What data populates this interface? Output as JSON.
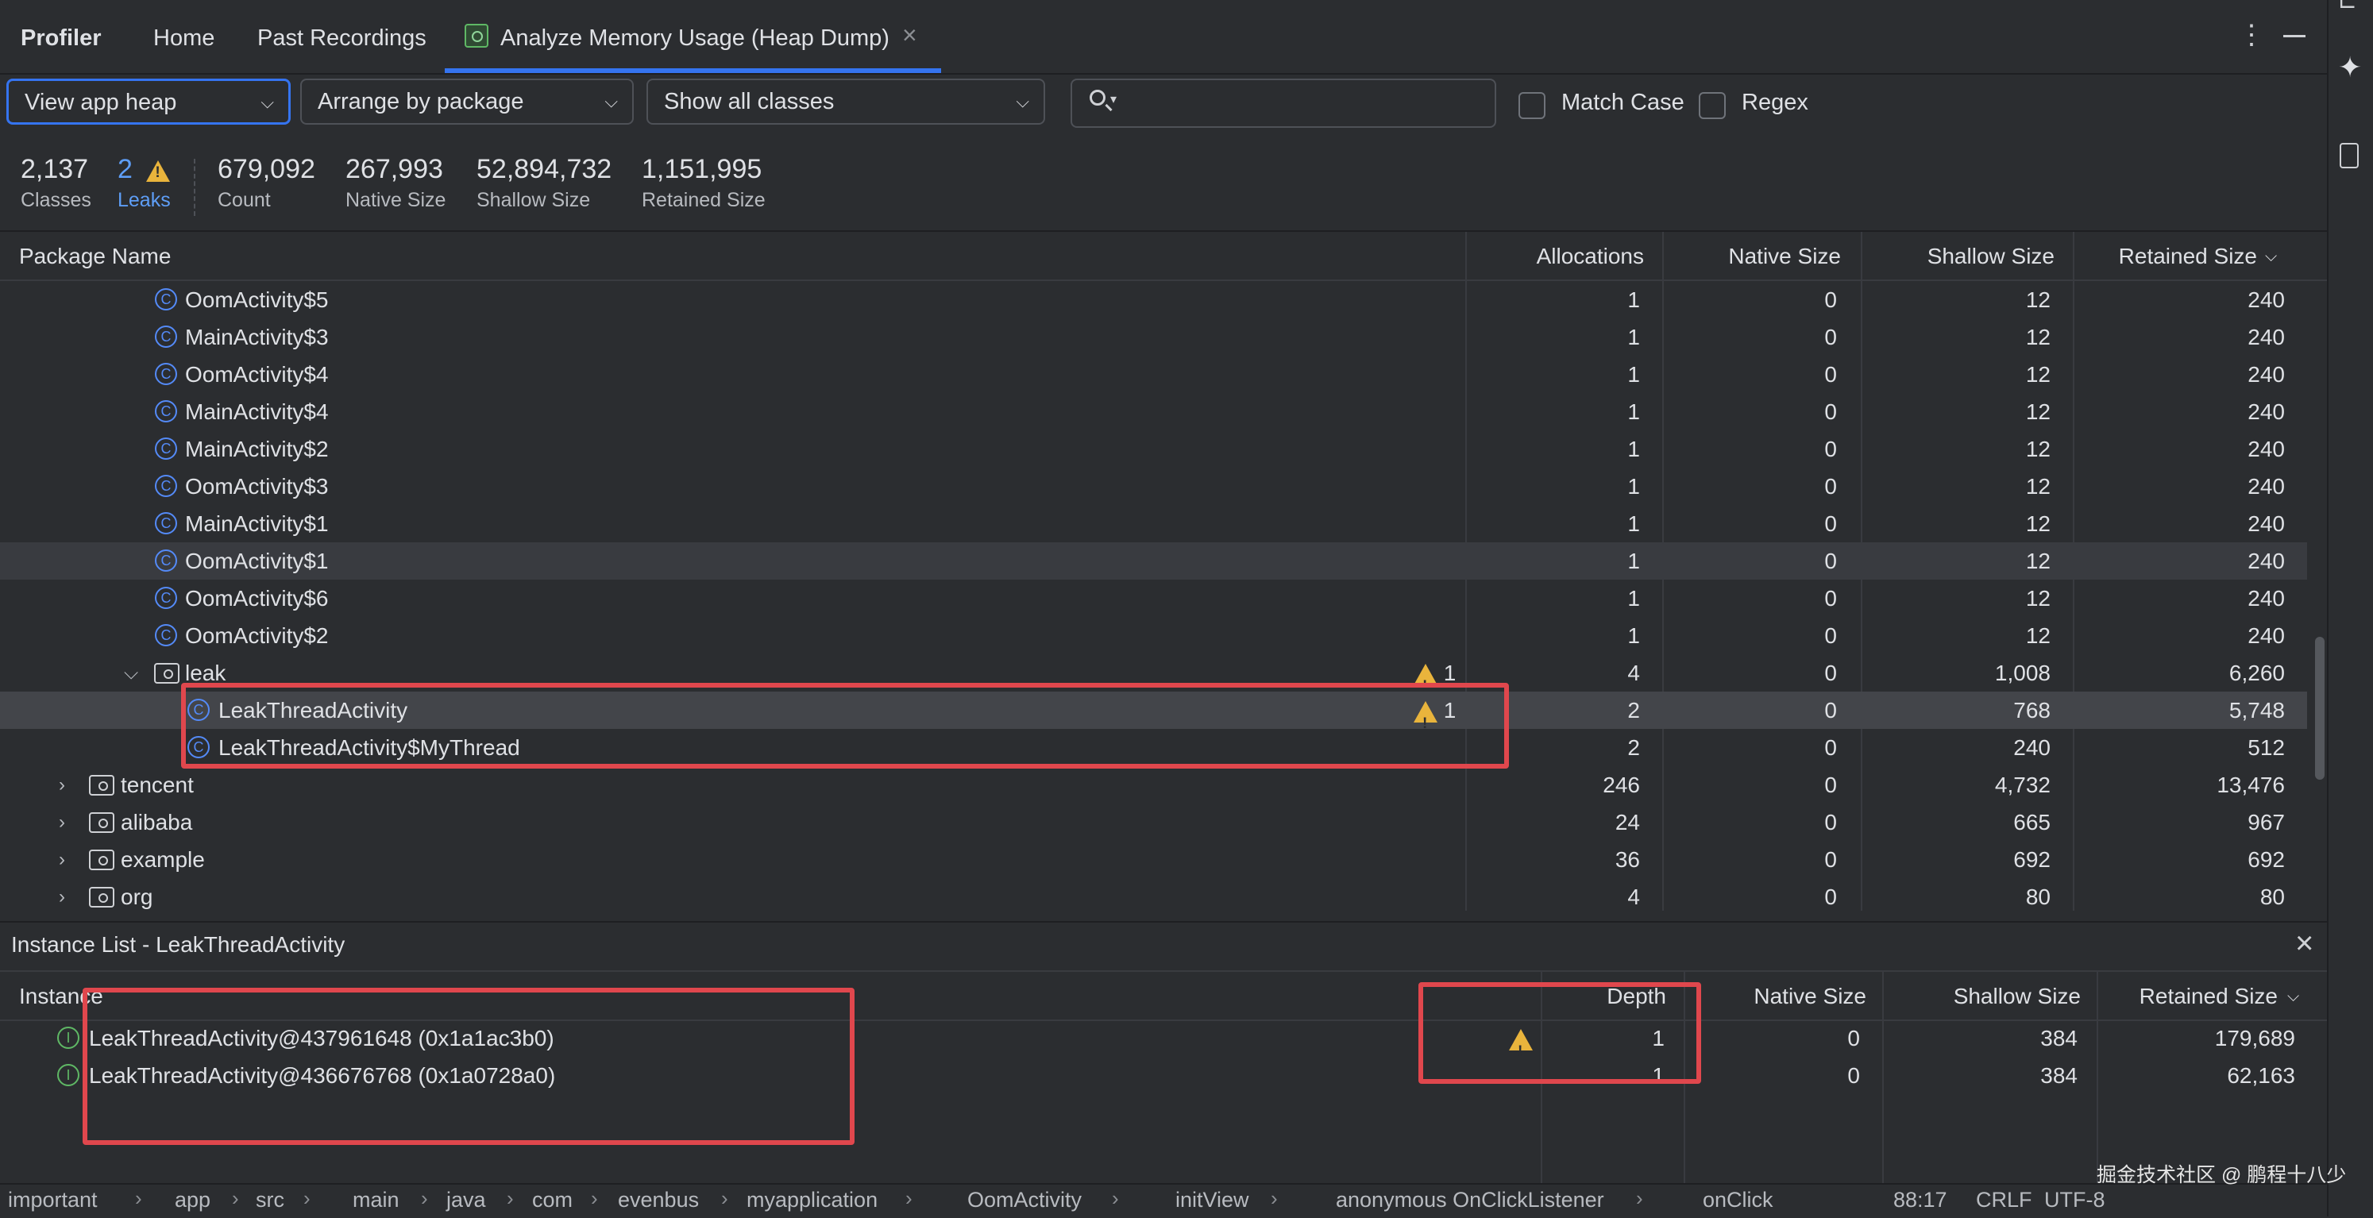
{
  "tabs": {
    "profiler": "Profiler",
    "home": "Home",
    "past_recordings": "Past Recordings",
    "active": "Analyze Memory Usage (Heap Dump)",
    "close": "×"
  },
  "toolbar": {
    "heap": "View app heap",
    "arrange": "Arrange by package",
    "classes_filter": "Show all classes",
    "match_case": "Match Case",
    "regex": "Regex"
  },
  "stats": {
    "classes_value": "2,137",
    "classes_label": "Classes",
    "leaks_value": "2",
    "leaks_label": "Leaks",
    "count_value": "679,092",
    "count_label": "Count",
    "native_value": "267,993",
    "native_label": "Native Size",
    "shallow_value": "52,894,732",
    "shallow_label": "Shallow Size",
    "retained_value": "1,151,995",
    "retained_label": "Retained Size"
  },
  "table": {
    "headers": {
      "name": "Package Name",
      "allocations": "Allocations",
      "native": "Native Size",
      "shallow": "Shallow Size",
      "retained": "Retained Size"
    },
    "rows": [
      {
        "name": "OomActivity$5",
        "alloc": "1",
        "native": "0",
        "shallow": "12",
        "retained": "240"
      },
      {
        "name": "MainActivity$3",
        "alloc": "1",
        "native": "0",
        "shallow": "12",
        "retained": "240"
      },
      {
        "name": "OomActivity$4",
        "alloc": "1",
        "native": "0",
        "shallow": "12",
        "retained": "240"
      },
      {
        "name": "MainActivity$4",
        "alloc": "1",
        "native": "0",
        "shallow": "12",
        "retained": "240"
      },
      {
        "name": "MainActivity$2",
        "alloc": "1",
        "native": "0",
        "shallow": "12",
        "retained": "240"
      },
      {
        "name": "OomActivity$3",
        "alloc": "1",
        "native": "0",
        "shallow": "12",
        "retained": "240"
      },
      {
        "name": "MainActivity$1",
        "alloc": "1",
        "native": "0",
        "shallow": "12",
        "retained": "240"
      },
      {
        "name": "OomActivity$1",
        "alloc": "1",
        "native": "0",
        "shallow": "12",
        "retained": "240"
      },
      {
        "name": "OomActivity$6",
        "alloc": "1",
        "native": "0",
        "shallow": "12",
        "retained": "240"
      },
      {
        "name": "OomActivity$2",
        "alloc": "1",
        "native": "0",
        "shallow": "12",
        "retained": "240"
      },
      {
        "name": "leak",
        "leaks": "1",
        "alloc": "4",
        "native": "0",
        "shallow": "1,008",
        "retained": "6,260"
      },
      {
        "name": "LeakThreadActivity",
        "leaks": "1",
        "alloc": "2",
        "native": "0",
        "shallow": "768",
        "retained": "5,748"
      },
      {
        "name": "LeakThreadActivity$MyThread",
        "alloc": "2",
        "native": "0",
        "shallow": "240",
        "retained": "512"
      },
      {
        "name": "tencent",
        "alloc": "246",
        "native": "0",
        "shallow": "4,732",
        "retained": "13,476"
      },
      {
        "name": "alibaba",
        "alloc": "24",
        "native": "0",
        "shallow": "665",
        "retained": "967"
      },
      {
        "name": "example",
        "alloc": "36",
        "native": "0",
        "shallow": "692",
        "retained": "692"
      },
      {
        "name": "org",
        "alloc": "4",
        "native": "0",
        "shallow": "80",
        "retained": "80"
      }
    ]
  },
  "instance_list": {
    "title": "Instance List - LeakThreadActivity",
    "headers": {
      "instance": "Instance",
      "depth": "Depth",
      "native": "Native Size",
      "shallow": "Shallow Size",
      "retained": "Retained Size"
    },
    "rows": [
      {
        "name": "LeakThreadActivity@437961648 (0x1a1ac3b0)",
        "depth": "1",
        "native": "0",
        "shallow": "384",
        "retained": "179,689"
      },
      {
        "name": "LeakThreadActivity@436676768 (0x1a0728a0)",
        "depth": "1",
        "native": "0",
        "shallow": "384",
        "retained": "62,163"
      }
    ]
  },
  "statusbar": {
    "crumbs": [
      "important",
      "app",
      "src",
      "main",
      "java",
      "com",
      "evenbus",
      "myapplication",
      "OomActivity",
      "initView",
      "anonymous OnClickListener",
      "onClick"
    ],
    "position": "88:17",
    "line_sep": "CRLF",
    "encoding": "UTF-8"
  },
  "watermark": "掘金技术社区 @ 鹏程十八少",
  "colors": {
    "accent": "#3574f0",
    "annotation_red": "#e0474d",
    "warning": "#e9b43c",
    "leak_link": "#5e9ef7"
  }
}
